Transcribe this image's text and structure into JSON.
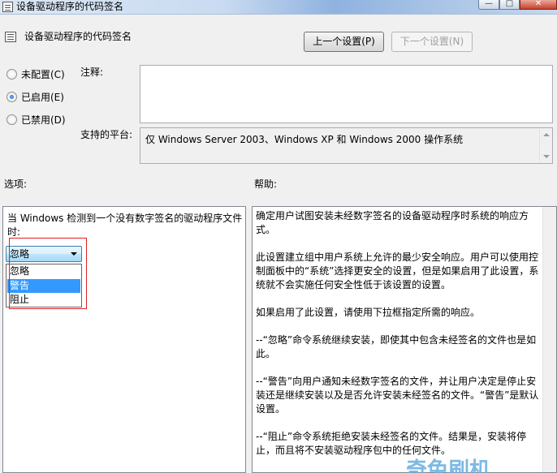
{
  "window": {
    "title": "设备驱动程序的代码签名",
    "controls": [
      "—",
      "□",
      "✕"
    ]
  },
  "header": {
    "policy_title": "设备驱动程序的代码签名",
    "prev_button": "上一个设置(P)",
    "next_button": "下一个设置(N)"
  },
  "state": {
    "options": [
      {
        "label": "未配置(C)",
        "checked": false
      },
      {
        "label": "已启用(E)",
        "checked": true
      },
      {
        "label": "已禁用(D)",
        "checked": false
      }
    ]
  },
  "comment": {
    "label": "注释:",
    "value": ""
  },
  "platform": {
    "label": "支持的平台:",
    "value": "仅 Windows Server 2003、Windows XP 和 Windows 2000 操作系统"
  },
  "options_pane": {
    "label": "选项:",
    "description": "当 Windows 检测到一个没有数字签名的驱动程序文件时:",
    "select_value": "忽略",
    "dropdown_items": [
      {
        "label": "忽略",
        "selected": false
      },
      {
        "label": "警告",
        "selected": true
      },
      {
        "label": "阻止",
        "selected": false
      }
    ]
  },
  "help_pane": {
    "label": "帮助:",
    "paragraphs": [
      "确定用户试图安装未经数字签名的设备驱动程序时系统的响应方式。",
      "此设置建立组中用户系统上允许的最少安全响应。用户可以使用控制面板中的“系统”选择更安全的设置，但是如果启用了此设置，系统就不会实施任何安全性低于该设置的设置。",
      "如果启用了此设置，请使用下拉框指定所需的响应。",
      "--“忽略”命令系统继续安装，即使其中包含未经签名的文件也是如此。",
      "--“警告”向用户通知未经数字签名的文件，并让用户决定是停止安装还是继续安装以及是否允许安装未经签名的文件。“警告”是默认设置。",
      "--“阻止”命令系统拒绝安装未经签名的文件。结果是，安装将停止，而且将不安装驱动程序包中的任何文件。"
    ]
  },
  "watermark": "奇兔刷机",
  "colors": {
    "accent": "#3399ff",
    "highlight_border": "#e02020",
    "background": "#f0f0f0"
  }
}
